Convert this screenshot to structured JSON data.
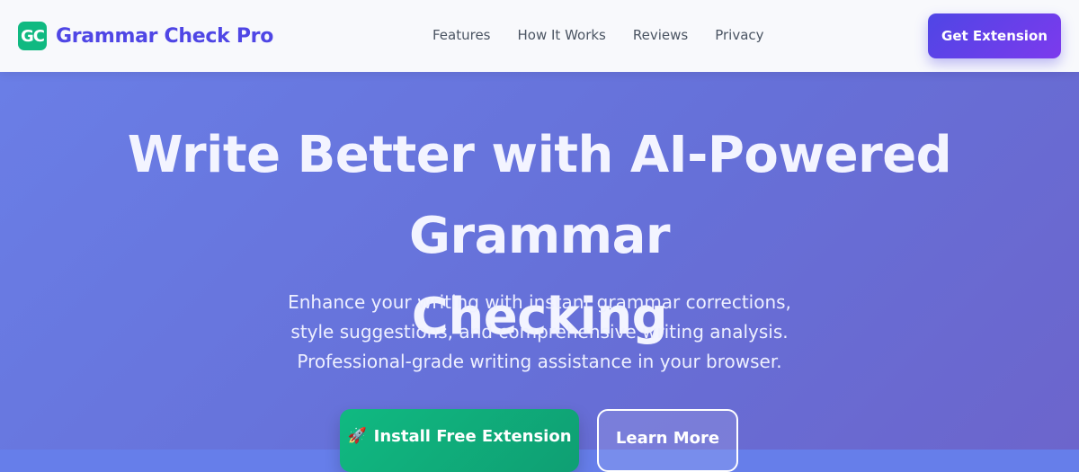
{
  "brand": {
    "logo_text": "GC",
    "name": "Grammar Check Pro",
    "logo_color": "#10b981",
    "name_color": "#4f46e5"
  },
  "nav": {
    "links": [
      "Features",
      "How It Works",
      "Reviews",
      "Privacy"
    ],
    "cta_label": "Get Extension"
  },
  "hero": {
    "title_line1": "Write Better with AI-Powered Grammar",
    "title_line2": "Checking",
    "subtitle": "Enhance your writing with instant grammar corrections, style suggestions, and comprehensive writing analysis. Professional-grade writing assistance in your browser.",
    "primary_button": {
      "icon": "🚀",
      "label": "Install Free Extension"
    },
    "secondary_button": {
      "label": "Learn More"
    }
  },
  "colors": {
    "hero_background": "#6a7ee6",
    "primary_button": "#10b981",
    "cta_button": "#4f46e5"
  }
}
